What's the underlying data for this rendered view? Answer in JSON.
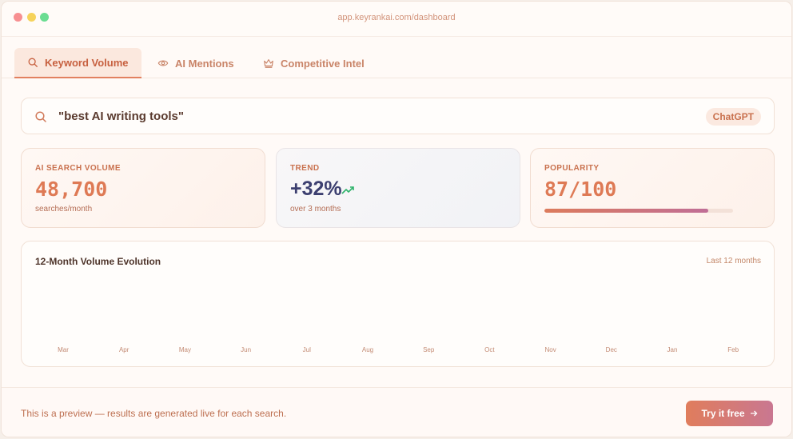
{
  "window": {
    "url": "app.keyrankai.com/dashboard"
  },
  "tabs": [
    {
      "label": "Keyword Volume",
      "icon": "search-icon",
      "active": true
    },
    {
      "label": "AI Mentions",
      "icon": "eye-icon",
      "active": false
    },
    {
      "label": "Competitive Intel",
      "icon": "crown-icon",
      "active": false
    }
  ],
  "search": {
    "query": "\"best AI writing tools\"",
    "engine": "ChatGPT"
  },
  "stats": {
    "volume": {
      "label": "AI SEARCH VOLUME",
      "value": "48,700",
      "sub": "searches/month"
    },
    "trend": {
      "label": "TREND",
      "value": "+32%",
      "sub": "over 3 months",
      "icon": "trending-up-icon"
    },
    "popularity": {
      "label": "POPULARITY",
      "value": "87/100",
      "fraction": 0.87
    }
  },
  "chart": {
    "title": "12-Month Volume Evolution",
    "range": "Last 12 months",
    "months": [
      "Mar",
      "Apr",
      "May",
      "Jun",
      "Jul",
      "Aug",
      "Sep",
      "Oct",
      "Nov",
      "Dec",
      "Jan",
      "Feb"
    ]
  },
  "footer": {
    "note": "This is a preview — results are generated live for each search.",
    "cta_label": "Try it free",
    "cta_icon": "arrow-right-icon"
  },
  "colors": {
    "accent": "#de7a55",
    "trend": "#3c3f70",
    "positive": "#2fb36b"
  }
}
